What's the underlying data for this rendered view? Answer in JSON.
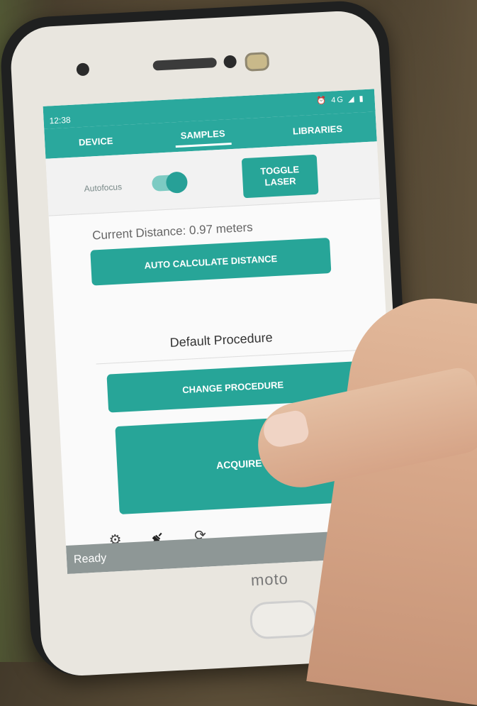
{
  "statusbar": {
    "time": "12:38",
    "icons": "⏰ 4G ◢ ▮"
  },
  "tabs": [
    {
      "label": "DEVICE",
      "active": false
    },
    {
      "label": "SAMPLES",
      "active": true
    },
    {
      "label": "LIBRARIES",
      "active": false
    }
  ],
  "controls": {
    "autofocus_label": "Autofocus",
    "autofocus_on": true,
    "toggle_laser_label": "TOGGLE\nLASER"
  },
  "distance": {
    "text": "Current Distance: 0.97 meters"
  },
  "buttons": {
    "auto_calc": "AUTO CALCULATE DISTANCE",
    "change_procedure": "CHANGE PROCEDURE",
    "acquire": "ACQUIRE"
  },
  "procedure": {
    "name": "Default Procedure"
  },
  "bottom_icons": [
    "settings-icon",
    "plug-icon",
    "refresh-icon",
    "more-vertical-icon"
  ],
  "status": {
    "text": "Ready"
  },
  "device": {
    "brand": "moto"
  },
  "colors": {
    "accent": "#27a598",
    "status_bar": "#8e9796"
  }
}
